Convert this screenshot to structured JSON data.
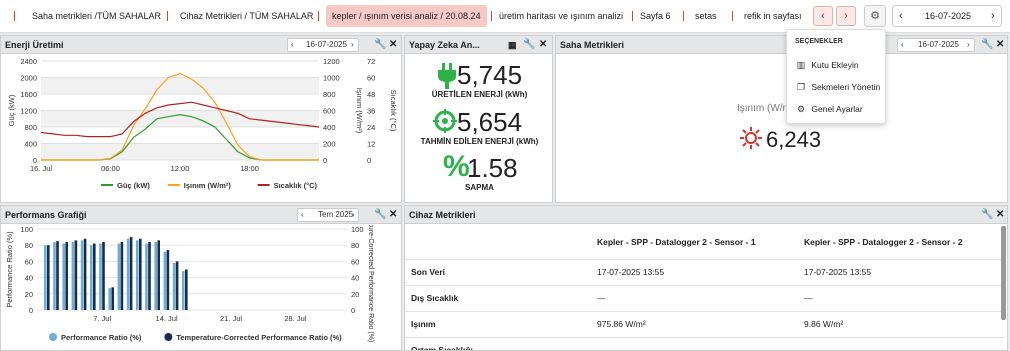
{
  "tabs": [
    {
      "label": "Saha metrikleri /TÜM SAHALAR",
      "active": false
    },
    {
      "label": "Cihaz Metrikleri / TÜM SAHALAR",
      "active": false
    },
    {
      "label": "kepler / ışınım verisi analiz / 20.08.24",
      "active": true
    },
    {
      "label": "üretim haritası ve ışınım analizi",
      "active": false
    },
    {
      "label": "Sayfa 6",
      "active": false
    },
    {
      "label": "setas",
      "active": false
    },
    {
      "label": "refik in sayfası",
      "active": false
    }
  ],
  "topbar": {
    "date": "16-07-2025",
    "prev_icon": "chevron-left-icon",
    "next_icon": "chevron-right-icon",
    "settings_icon": "gear-icon"
  },
  "settings_menu": {
    "title": "SEÇENEKLER",
    "items": [
      {
        "label": "Kutu Ekleyin",
        "icon": "chart-box-icon"
      },
      {
        "label": "Sekmeleri Yönetin",
        "icon": "copy-tabs-icon"
      },
      {
        "label": "Genel Ayarlar",
        "icon": "cogs-icon"
      }
    ]
  },
  "energy_panel": {
    "title": "Enerji Üretimi",
    "date": "16-07-2025"
  },
  "ai_panel": {
    "title": "Yapay Zeka An...",
    "kpis": [
      {
        "value": "5,745",
        "label": "ÜRETİLEN ENERJİ (kWh)",
        "icon": "plug-icon"
      },
      {
        "value": "5,654",
        "label": "TAHMİN EDİLEN ENERJİ (kWh)",
        "icon": "crosshair-icon"
      },
      {
        "value": "1.58",
        "label": "SAPMA",
        "icon": "percent-icon"
      }
    ]
  },
  "site_panel": {
    "title": "Saha Metrikleri",
    "date": "16-07-2025",
    "label": "Işınım (W/m²)",
    "value": "6,243",
    "icon": "sun-icon"
  },
  "performance_panel": {
    "title": "Performans Grafiği",
    "period": "Tem 2025"
  },
  "device_panel": {
    "title": "Cihaz Metrikleri",
    "columns": [
      "",
      "Kepler - SPP - Datalogger 2 - Sensor - 1",
      "Kepler - SPP - Datalogger 2 - Sensor - 2"
    ],
    "rows": [
      [
        "Son Veri",
        "17-07-2025 13:55",
        "17-07-2025 13:55"
      ],
      [
        "Dış Sıcaklık",
        "—",
        "—"
      ],
      [
        "Işınım",
        "975.86 W/m²",
        "9.86 W/m²"
      ],
      [
        "Ortam Sıcaklığı",
        "—",
        "—"
      ]
    ]
  },
  "chart_data": [
    {
      "type": "line",
      "title": "",
      "xlabel": "",
      "x_ticks": [
        "16. Jul",
        "06:00",
        "12:00",
        "18:00"
      ],
      "axes": [
        {
          "label": "Güç (kW)",
          "side": "left",
          "range": [
            0,
            2400
          ],
          "ticks": [
            0,
            400,
            800,
            1200,
            1600,
            2000,
            2400
          ]
        },
        {
          "label": "Işınım (W/m²)",
          "side": "right",
          "range": [
            0,
            1200
          ],
          "ticks": [
            0,
            200,
            400,
            600,
            800,
            1000,
            1200
          ]
        },
        {
          "label": "Sıcaklık (°C)",
          "side": "right",
          "range": [
            0,
            72
          ],
          "ticks": [
            0,
            12,
            24,
            36,
            48,
            60,
            72
          ]
        }
      ],
      "x_hours": [
        0,
        1,
        2,
        3,
        4,
        5,
        6,
        7,
        8,
        9,
        10,
        11,
        12,
        13,
        14,
        15,
        16,
        17,
        18,
        19,
        20,
        21,
        22,
        23,
        24
      ],
      "series": [
        {
          "name": "Güç (kW)",
          "color": "#2ca02c",
          "axis": 0,
          "values": [
            0,
            0,
            0,
            0,
            0,
            0,
            30,
            200,
            550,
            750,
            1000,
            1050,
            1100,
            1050,
            950,
            800,
            500,
            200,
            50,
            0,
            0,
            0,
            0,
            0,
            0
          ]
        },
        {
          "name": "Işınım (W/m²)",
          "color": "#ff9f1c",
          "axis": 1,
          "values": [
            0,
            0,
            0,
            0,
            0,
            0,
            20,
            120,
            420,
            620,
            850,
            1000,
            1050,
            980,
            870,
            700,
            450,
            180,
            40,
            0,
            0,
            0,
            0,
            0,
            0
          ]
        },
        {
          "name": "Sıcaklık (°C)",
          "color": "#b22222",
          "axis": 2,
          "values": [
            20,
            19,
            18,
            18,
            17,
            17,
            17,
            19,
            28,
            34,
            38,
            40,
            41,
            42,
            40,
            38,
            36,
            34,
            30,
            29,
            28,
            27,
            26,
            25,
            24
          ]
        }
      ],
      "grid": true,
      "legend": "bottom"
    },
    {
      "type": "bar",
      "title": "",
      "x_ticks": [
        "7. Jul",
        "14. Jul",
        "21. Jul",
        "28. Jul"
      ],
      "ylabel_left": "Performance Ratio (%)",
      "ylabel_right": "Temperature-Corrected Performance Ratio (%)",
      "ylim": [
        0,
        100
      ],
      "y_ticks": [
        0,
        20,
        40,
        60,
        80,
        100
      ],
      "days": [
        1,
        2,
        3,
        4,
        5,
        6,
        7,
        8,
        9,
        10,
        11,
        12,
        13,
        14,
        15,
        16
      ],
      "series": [
        {
          "name": "Performance Ratio (%)",
          "color": "#6baed6",
          "values": [
            80,
            84,
            82,
            84,
            86,
            80,
            82,
            27,
            82,
            88,
            86,
            82,
            84,
            72,
            58,
            48
          ]
        },
        {
          "name": "Temperature-Corrected Performance Ratio (%)",
          "color": "#1a2b4c",
          "values": [
            80,
            85,
            84,
            86,
            88,
            82,
            84,
            28,
            84,
            90,
            88,
            84,
            86,
            74,
            60,
            50
          ]
        }
      ],
      "grid": true,
      "legend": "bottom"
    }
  ]
}
